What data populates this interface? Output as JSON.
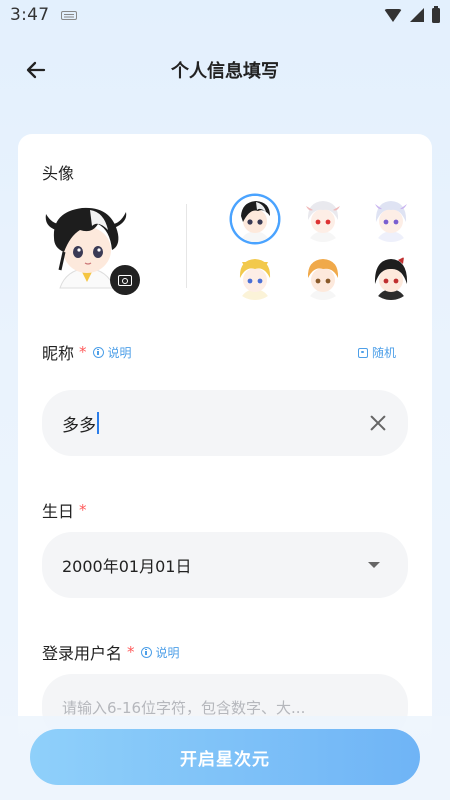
{
  "status_bar": {
    "time": "3:47"
  },
  "header": {
    "title": "个人信息填写"
  },
  "avatar_section": {
    "label": "头像",
    "options": [
      {
        "name": "black-white-hair-avatar",
        "selected": true
      },
      {
        "name": "white-hair-red-eyes-avatar",
        "selected": false
      },
      {
        "name": "silver-hair-purple-eyes-avatar",
        "selected": false
      },
      {
        "name": "blonde-hair-avatar",
        "selected": false
      },
      {
        "name": "orange-hair-avatar",
        "selected": false
      },
      {
        "name": "black-hair-bow-avatar",
        "selected": false
      }
    ]
  },
  "nickname": {
    "label": "昵称",
    "required_mark": "*",
    "hint": "说明",
    "random_label": "随机",
    "value": "多多"
  },
  "birthday": {
    "label": "生日",
    "required_mark": "*",
    "value": "2000年01月01日"
  },
  "username": {
    "label": "登录用户名",
    "required_mark": "*",
    "hint": "说明",
    "placeholder": "请输入6-16位字符，包含数字、大..."
  },
  "submit_button": {
    "label": "开启星次元"
  },
  "colors": {
    "accent": "#4d9fe8",
    "required": "#ff5a5a",
    "button_start": "#8fd0fa",
    "button_end": "#6fb4f6"
  }
}
